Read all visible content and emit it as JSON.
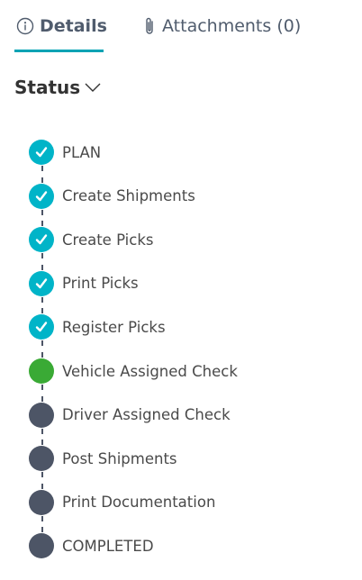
{
  "tabs": [
    {
      "label": "Details",
      "icon": "info-circle-icon",
      "active": true
    },
    {
      "label": "Attachments (0)",
      "icon": "paperclip-icon",
      "active": false
    }
  ],
  "status_section": {
    "title": "Status",
    "expanded": true
  },
  "colors": {
    "accent": "#00a3b4",
    "completed": "#00b4c8",
    "current": "#3aaa35",
    "pending": "#4d5566"
  },
  "steps": [
    {
      "label": "PLAN",
      "state": "completed"
    },
    {
      "label": "Create Shipments",
      "state": "completed"
    },
    {
      "label": "Create Picks",
      "state": "completed"
    },
    {
      "label": "Print Picks",
      "state": "completed"
    },
    {
      "label": "Register Picks",
      "state": "completed"
    },
    {
      "label": "Vehicle Assigned Check",
      "state": "current"
    },
    {
      "label": "Driver Assigned Check",
      "state": "pending"
    },
    {
      "label": "Post Shipments",
      "state": "pending"
    },
    {
      "label": "Print Documentation",
      "state": "pending"
    },
    {
      "label": "COMPLETED",
      "state": "pending"
    }
  ]
}
